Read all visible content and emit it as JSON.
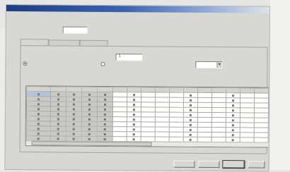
{
  "window": {
    "title": ""
  },
  "menu": [
    "",
    ""
  ],
  "top_field": {
    "label": "",
    "value": ""
  },
  "tabs": [
    {
      "label": "",
      "active": true
    },
    {
      "label": "",
      "active": false
    },
    {
      "label": "",
      "active": false
    }
  ],
  "settings": {
    "row1_label": "",
    "row1_value": "1",
    "radio1_label": "",
    "radio1_selected": true,
    "radio2_label": "",
    "radio2_selected": false,
    "select_value": ""
  },
  "grid": {
    "columns": [
      "",
      "",
      "",
      "",
      "",
      "",
      "",
      "",
      "",
      "",
      "",
      "",
      "",
      "",
      "",
      ""
    ],
    "row_count": 11
  },
  "buttons": [
    "",
    "",
    "",
    ""
  ]
}
